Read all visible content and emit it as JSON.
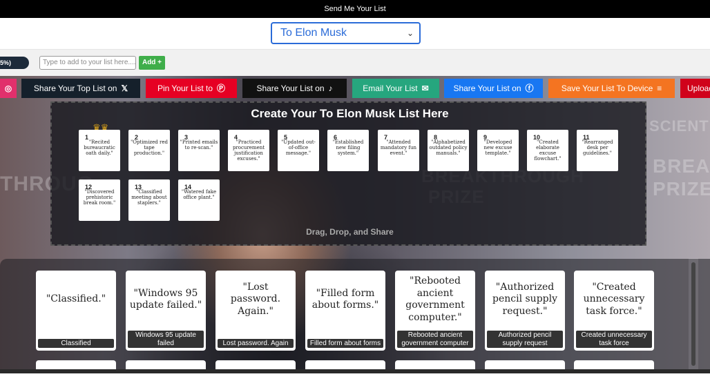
{
  "header": {
    "title": "Send Me Your List"
  },
  "selector": {
    "value": "To Elon Musk"
  },
  "toolbar": {
    "progress": "5%)",
    "input_placeholder": "Type to add to your list here....",
    "add_label": "Add +"
  },
  "share_buttons": [
    {
      "label": "",
      "color": "#e1306c",
      "icon": "instagram-icon",
      "glyph": "◎"
    },
    {
      "label": "Share Your Top List on",
      "color": "#15202b",
      "icon": "x-icon",
      "glyph": "𝕏"
    },
    {
      "label": "Pin Your List to",
      "color": "#e60023",
      "icon": "pinterest-icon",
      "glyph": "Ⓟ"
    },
    {
      "label": "Share Your List on",
      "color": "#111111",
      "icon": "tiktok-icon",
      "glyph": "♪"
    },
    {
      "label": "Email Your List",
      "color": "#26a67e",
      "icon": "mail-icon",
      "glyph": "✉"
    },
    {
      "label": "Share Your List on",
      "color": "#1877f2",
      "icon": "facebook-icon",
      "glyph": "ⓕ"
    },
    {
      "label": "Save Your List To Device",
      "color": "#f47421",
      "icon": "list-icon",
      "glyph": "≡"
    },
    {
      "label": "Upload",
      "color": "#d0021b",
      "icon": "upload-icon",
      "glyph": ""
    }
  ],
  "panel": {
    "title": "Create Your To Elon Musk List Here",
    "footer": "Drag, Drop, and Share"
  },
  "list_items": [
    {
      "num": "1",
      "text": "\"Recited bureaucratic oath daily.\""
    },
    {
      "num": "2",
      "text": "\"Optimized red tape production.\""
    },
    {
      "num": "3",
      "text": "\"Printed emails to re-scan.\""
    },
    {
      "num": "4",
      "text": "\"Practiced procurement justification excuses.\""
    },
    {
      "num": "5",
      "text": "\"Updated out-of-office message.\""
    },
    {
      "num": "6",
      "text": "\"Established new filing system.\""
    },
    {
      "num": "7",
      "text": "\"Attended mandatory fun event.\""
    },
    {
      "num": "8",
      "text": "\"Alphabetized outdated policy manuals.\""
    },
    {
      "num": "9",
      "text": "\"Developed new excuse template.\""
    },
    {
      "num": "10",
      "text": "\"Created elaborate excuse flowchart.\""
    },
    {
      "num": "11",
      "text": "\"Rearranged desk per guidelines.\""
    },
    {
      "num": "12",
      "text": "\"Discovered prehistoric break room.\""
    },
    {
      "num": "13",
      "text": "\"Classified meeting about staplers.\""
    },
    {
      "num": "14",
      "text": "\"Watered fake office plant.\""
    }
  ],
  "cards": [
    {
      "quote": "\"Classified.\"",
      "caption": "Classified"
    },
    {
      "quote": "\"Windows 95 update failed.\"",
      "caption": "Windows 95 update failed"
    },
    {
      "quote": "\"Lost password. Again.\"",
      "caption": "Lost password. Again"
    },
    {
      "quote": "\"Filled form about forms.\"",
      "caption": "Filled form about forms"
    },
    {
      "quote": "\"Rebooted ancient government computer.\"",
      "caption": "Rebooted ancient government computer"
    },
    {
      "quote": "\"Authorized pencil supply request.\"",
      "caption": "Authorized pencil supply request"
    },
    {
      "quote": "\"Created unnecessary task force.\"",
      "caption": "Created unnecessary task force"
    }
  ]
}
